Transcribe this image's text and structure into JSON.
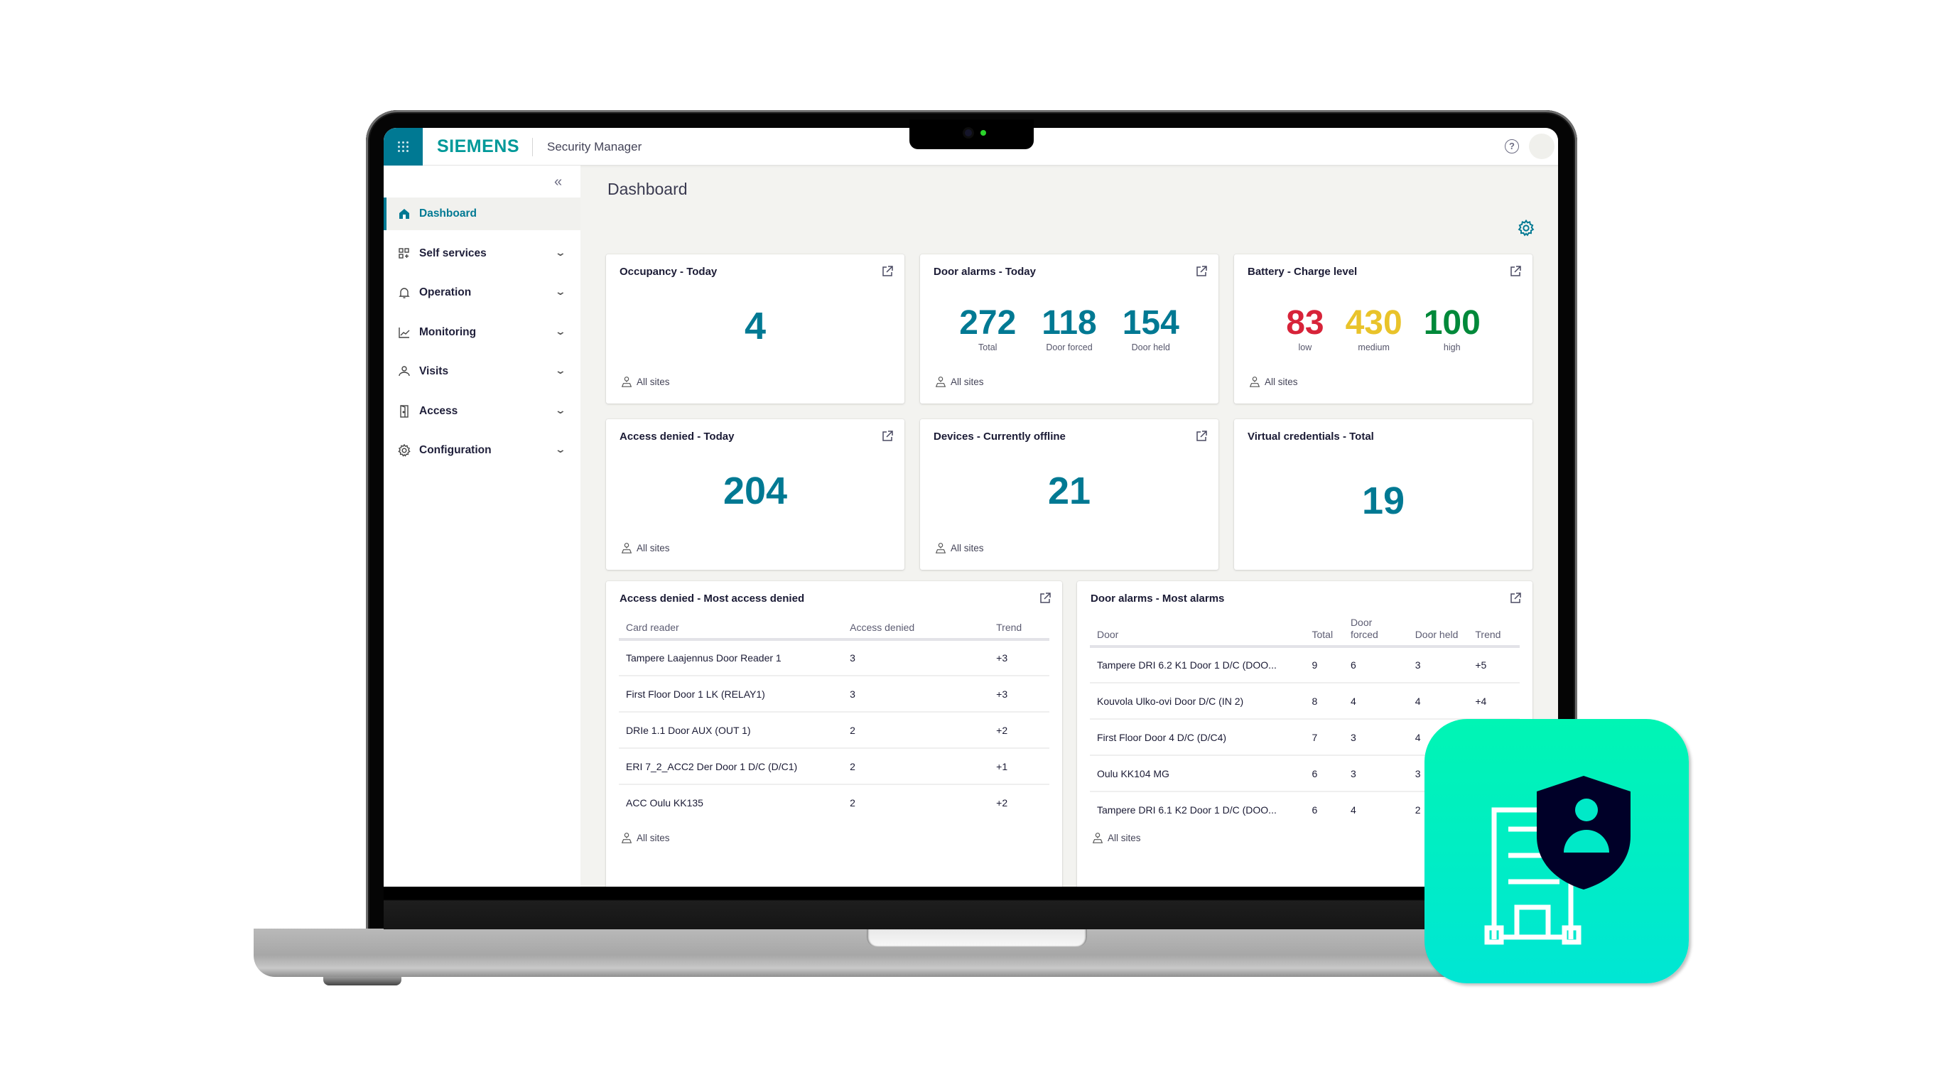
{
  "header": {
    "brand": "SIEMENS",
    "app_title": "Security Manager",
    "help_label": "?",
    "brand_color": "#009999",
    "accent_color": "#007993"
  },
  "sidebar": {
    "collapse_label": "«",
    "items": [
      {
        "label": "Dashboard",
        "icon": "home-icon",
        "active": true
      },
      {
        "label": "Self services",
        "icon": "apps-add-icon",
        "expandable": true
      },
      {
        "label": "Operation",
        "icon": "bell-icon",
        "expandable": true
      },
      {
        "label": "Monitoring",
        "icon": "trend-chart-icon",
        "expandable": true
      },
      {
        "label": "Visits",
        "icon": "user-icon",
        "expandable": true
      },
      {
        "label": "Access",
        "icon": "door-icon",
        "expandable": true
      },
      {
        "label": "Configuration",
        "icon": "gear-icon",
        "expandable": true
      }
    ]
  },
  "main": {
    "page_title": "Dashboard",
    "scope_label": "All sites",
    "cards": {
      "occupancy": {
        "title": "Occupancy - Today",
        "value": "4"
      },
      "door_alarms": {
        "title": "Door alarms - Today",
        "stats": [
          {
            "value": "272",
            "label": "Total"
          },
          {
            "value": "118",
            "label": "Door forced"
          },
          {
            "value": "154",
            "label": "Door held"
          }
        ]
      },
      "battery": {
        "title": "Battery - Charge level",
        "stats": [
          {
            "value": "83",
            "label": "low",
            "color": "#d72339"
          },
          {
            "value": "430",
            "label": "medium",
            "color": "#e9c32a"
          },
          {
            "value": "100",
            "label": "high",
            "color": "#01893a"
          }
        ]
      },
      "access_denied": {
        "title": "Access denied - Today",
        "value": "204"
      },
      "devices_offline": {
        "title": "Devices - Currently offline",
        "value": "21"
      },
      "virtual_credentials": {
        "title": "Virtual credentials - Total",
        "value": "19"
      }
    },
    "most_access_denied": {
      "title": "Access denied - Most access denied",
      "columns": [
        "Card reader",
        "Access denied",
        "Trend"
      ],
      "rows": [
        [
          "Tampere Laajennus Door Reader 1",
          "3",
          "+3"
        ],
        [
          "First Floor Door 1 LK (RELAY1)",
          "3",
          "+3"
        ],
        [
          "DRIe 1.1 Door AUX (OUT 1)",
          "2",
          "+2"
        ],
        [
          "ERI 7_2_ACC2 Der Door 1 D/C (D/C1)",
          "2",
          "+1"
        ],
        [
          "ACC Oulu KK135",
          "2",
          "+2"
        ]
      ]
    },
    "most_alarms": {
      "title": "Door alarms - Most alarms",
      "columns": [
        "Door",
        "Total",
        "Door forced",
        "Door held",
        "Trend"
      ],
      "rows": [
        [
          "Tampere DRI 6.2 K1 Door 1 D/C (DOO...",
          "9",
          "6",
          "3",
          "+5"
        ],
        [
          "Kouvola Ulko-ovi Door D/C (IN 2)",
          "8",
          "4",
          "4",
          "+4"
        ],
        [
          "First Floor Door 4 D/C (D/C4)",
          "7",
          "3",
          "4",
          ""
        ],
        [
          "Oulu KK104 MG",
          "6",
          "3",
          "3",
          ""
        ],
        [
          "Tampere DRI 6.1 K2 Door 1 D/C (DOO...",
          "6",
          "4",
          "2",
          ""
        ]
      ]
    }
  },
  "app_icon": {
    "name": "security-manager-app-icon",
    "gradient": [
      "#00f5b4",
      "#00e6d4"
    ],
    "shield_color": "#000028"
  }
}
